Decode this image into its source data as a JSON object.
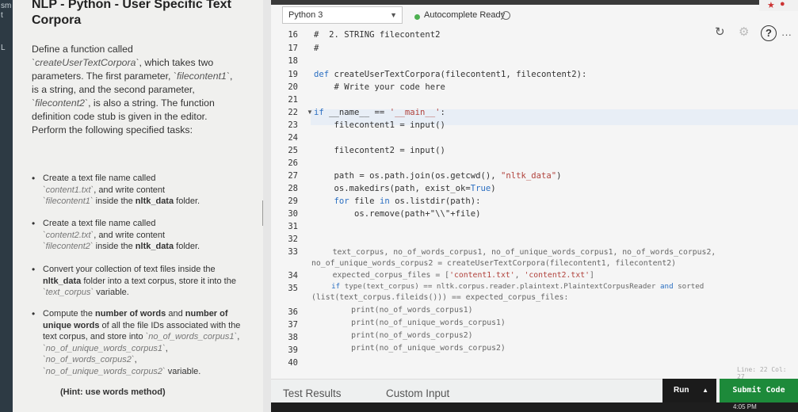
{
  "left_strip": {
    "fragments": [
      "sm",
      "t",
      "L"
    ]
  },
  "problem": {
    "title": "NLP - Python - User Specific Text Corpora",
    "intro": {
      "p1": "Define a function called",
      "fn_name": "`createUserTextCorpora`",
      "p2": ", which takes two parameters. The first parameter,",
      "param1": "`filecontent1`",
      "p3": ", is a string, and the second parameter,",
      "param2": "`filecontent2`",
      "p4": ", is also a string. The function definition code stub is given in the editor. Perform the following specified tasks:"
    },
    "tasks": [
      {
        "a": "Create a text file name called",
        "b": "`content1.txt`",
        "c": ", and write content",
        "d": "`filecontent1`",
        "e": " inside the ",
        "f": "nltk_data",
        "g": " folder."
      },
      {
        "a": "Create a text file name called",
        "b": "`content2.txt`",
        "c": ", and write content",
        "d": "`filecontent2`",
        "e": " inside the ",
        "f": "nltk_data",
        "g": " folder."
      },
      {
        "a": "Convert your collection of text files inside the ",
        "b": "nltk_data",
        "c": " folder into a text corpus, store it into the ",
        "d": "`text_corpus`",
        "e": " variable."
      },
      {
        "a": "Compute the ",
        "b": "number of words",
        "c": " and ",
        "d": "number of unique words",
        "e": " of all the file IDs associated with the text corpus, and store into ",
        "f": "`no_of_words_corpus1`",
        "g": ", ",
        "h": "`no_of_unique_words_corpus1`",
        "i": ", ",
        "j": "`no_of_words_corpus2`",
        "k": ", ",
        "l": "`no_of_unique_words_corpus2`",
        "m": " variable."
      }
    ],
    "hint": "(Hint: use words method)"
  },
  "editor": {
    "language": "Python 3",
    "autocomplete_status": "Autocomplete Ready",
    "line_col": "Line: 22 Col: 27",
    "line_numbers": [
      "16",
      "17",
      "18",
      "19",
      "20",
      "21",
      "22",
      "23",
      "24",
      "25",
      "26",
      "27",
      "28",
      "29",
      "30",
      "31",
      "32",
      "33",
      "34",
      "35",
      "36",
      "37",
      "38",
      "39",
      "40"
    ],
    "code": {
      "l16": "#  2. STRING filecontent2",
      "l17": "#",
      "l19_def": "def",
      "l19_rest": " createUserTextCorpora(filecontent1, filecontent2):",
      "l20": "    # Write your code here",
      "l22_if": "if",
      "l22_a": " __name__ == ",
      "l22_str": "'__main__'",
      "l22_b": ":",
      "l23": "    filecontent1 = input()",
      "l25": "    filecontent2 = input()",
      "l27_a": "    path = os.path.join(os.getcwd(), ",
      "l27_str": "\"nltk_data\"",
      "l27_b": ")",
      "l28_a": "    os.makedirs(path, exist_ok=",
      "l28_kw": "True",
      "l28_b": ")",
      "l29_for": "    for",
      "l29_a": " file ",
      "l29_in": "in",
      "l29_b": " os.listdir(path):",
      "l30": "        os.remove(path+\"\\\\\"+file)",
      "l33": "    text_corpus, no_of_words_corpus1, no_of_unique_words_corpus1, no_of_words_corpus2,",
      "l33_wrap": "no_of_unique_words_corpus2 = createUserTextCorpora(filecontent1, filecontent2)",
      "l34_a": "    expected_corpus_files = [",
      "l34_s1": "'content1.txt'",
      "l34_b": ", ",
      "l34_s2": "'content2.txt'",
      "l34_c": "]",
      "l35_if": "    if",
      "l35_a": " type(text_corpus) == nltk.corpus.reader.plaintext.PlaintextCorpusReader ",
      "l35_and": "and",
      "l35_b": " sorted",
      "l35_wrap": "(list(text_corpus.fileids())) == expected_corpus_files:",
      "l36": "        print(no_of_words_corpus1)",
      "l37": "        print(no_of_unique_words_corpus1)",
      "l38": "        print(no_of_words_corpus2)",
      "l39": "        print(no_of_unique_words_corpus2)"
    }
  },
  "bottom": {
    "tab_results": "Test Results",
    "tab_custom": "Custom Input",
    "run": "Run",
    "submit": "Submit Code",
    "clock": "4:05 PM"
  },
  "colors": {
    "accent_green": "#1d8a3a",
    "keyword_blue": "#2b6fc2",
    "string_red": "#b1433d"
  }
}
